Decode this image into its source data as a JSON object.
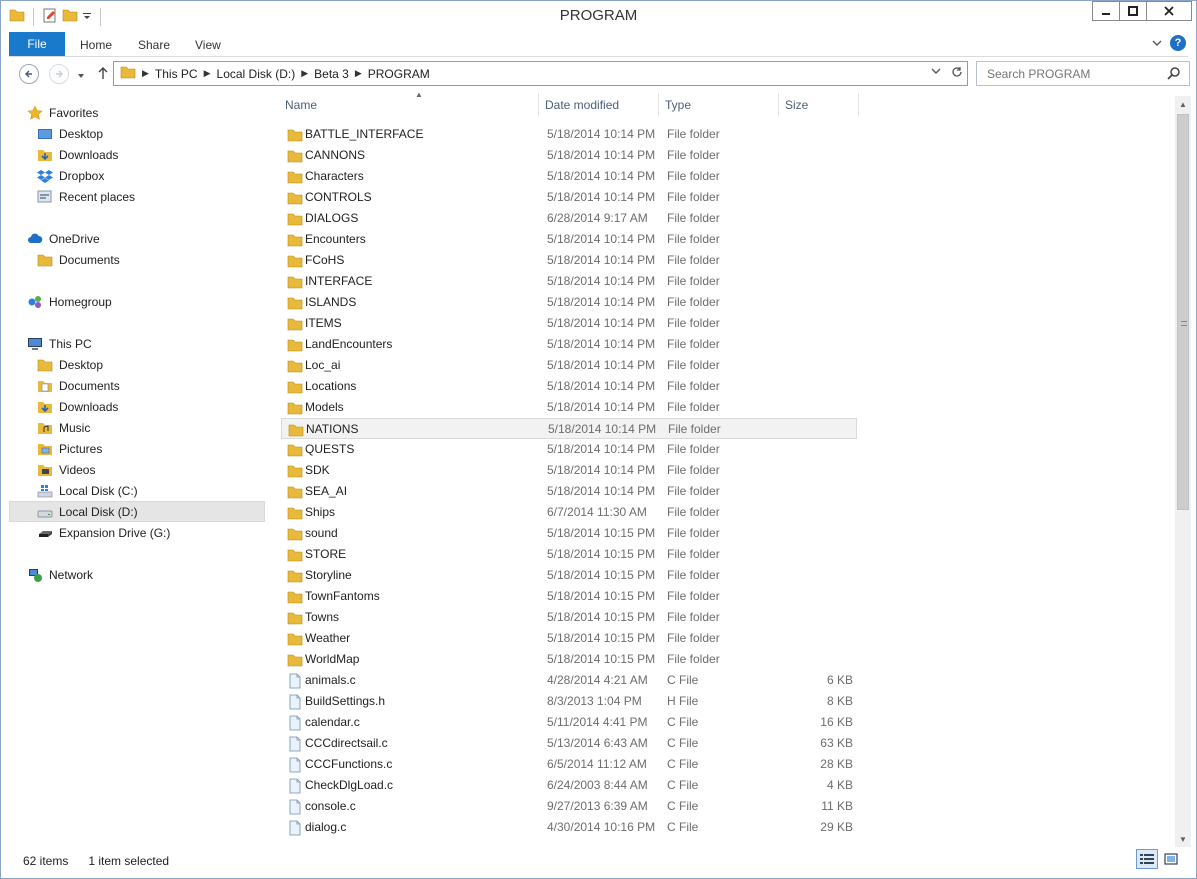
{
  "window": {
    "title": "PROGRAM"
  },
  "ribbon": {
    "file": "File",
    "home": "Home",
    "share": "Share",
    "view": "View"
  },
  "address": {
    "crumbs": [
      "This PC",
      "Local Disk (D:)",
      "Beta 3",
      "PROGRAM"
    ]
  },
  "search": {
    "placeholder": "Search PROGRAM"
  },
  "nav": {
    "favorites": "Favorites",
    "desktop": "Desktop",
    "downloads": "Downloads",
    "dropbox": "Dropbox",
    "recent": "Recent places",
    "onedrive": "OneDrive",
    "od_documents": "Documents",
    "homegroup": "Homegroup",
    "thispc": "This PC",
    "pc_desktop": "Desktop",
    "pc_documents": "Documents",
    "pc_downloads": "Downloads",
    "pc_music": "Music",
    "pc_pictures": "Pictures",
    "pc_videos": "Videos",
    "disk_c": "Local Disk (C:)",
    "disk_d": "Local Disk (D:)",
    "drive_g": "Expansion Drive (G:)",
    "network": "Network"
  },
  "columns": {
    "name": "Name",
    "date": "Date modified",
    "type": "Type",
    "size": "Size"
  },
  "files": [
    {
      "name": "BATTLE_INTERFACE",
      "date": "5/18/2014 10:14 PM",
      "type": "File folder",
      "size": "",
      "kind": "folder"
    },
    {
      "name": "CANNONS",
      "date": "5/18/2014 10:14 PM",
      "type": "File folder",
      "size": "",
      "kind": "folder"
    },
    {
      "name": "Characters",
      "date": "5/18/2014 10:14 PM",
      "type": "File folder",
      "size": "",
      "kind": "folder"
    },
    {
      "name": "CONTROLS",
      "date": "5/18/2014 10:14 PM",
      "type": "File folder",
      "size": "",
      "kind": "folder"
    },
    {
      "name": "DIALOGS",
      "date": "6/28/2014 9:17 AM",
      "type": "File folder",
      "size": "",
      "kind": "folder"
    },
    {
      "name": "Encounters",
      "date": "5/18/2014 10:14 PM",
      "type": "File folder",
      "size": "",
      "kind": "folder"
    },
    {
      "name": "FCoHS",
      "date": "5/18/2014 10:14 PM",
      "type": "File folder",
      "size": "",
      "kind": "folder"
    },
    {
      "name": "INTERFACE",
      "date": "5/18/2014 10:14 PM",
      "type": "File folder",
      "size": "",
      "kind": "folder"
    },
    {
      "name": "ISLANDS",
      "date": "5/18/2014 10:14 PM",
      "type": "File folder",
      "size": "",
      "kind": "folder"
    },
    {
      "name": "ITEMS",
      "date": "5/18/2014 10:14 PM",
      "type": "File folder",
      "size": "",
      "kind": "folder"
    },
    {
      "name": "LandEncounters",
      "date": "5/18/2014 10:14 PM",
      "type": "File folder",
      "size": "",
      "kind": "folder"
    },
    {
      "name": "Loc_ai",
      "date": "5/18/2014 10:14 PM",
      "type": "File folder",
      "size": "",
      "kind": "folder"
    },
    {
      "name": "Locations",
      "date": "5/18/2014 10:14 PM",
      "type": "File folder",
      "size": "",
      "kind": "folder"
    },
    {
      "name": "Models",
      "date": "5/18/2014 10:14 PM",
      "type": "File folder",
      "size": "",
      "kind": "folder"
    },
    {
      "name": "NATIONS",
      "date": "5/18/2014 10:14 PM",
      "type": "File folder",
      "size": "",
      "kind": "folder",
      "selected": true
    },
    {
      "name": "QUESTS",
      "date": "5/18/2014 10:14 PM",
      "type": "File folder",
      "size": "",
      "kind": "folder"
    },
    {
      "name": "SDK",
      "date": "5/18/2014 10:14 PM",
      "type": "File folder",
      "size": "",
      "kind": "folder"
    },
    {
      "name": "SEA_AI",
      "date": "5/18/2014 10:14 PM",
      "type": "File folder",
      "size": "",
      "kind": "folder"
    },
    {
      "name": "Ships",
      "date": "6/7/2014 11:30 AM",
      "type": "File folder",
      "size": "",
      "kind": "folder"
    },
    {
      "name": "sound",
      "date": "5/18/2014 10:15 PM",
      "type": "File folder",
      "size": "",
      "kind": "folder"
    },
    {
      "name": "STORE",
      "date": "5/18/2014 10:15 PM",
      "type": "File folder",
      "size": "",
      "kind": "folder"
    },
    {
      "name": "Storyline",
      "date": "5/18/2014 10:15 PM",
      "type": "File folder",
      "size": "",
      "kind": "folder"
    },
    {
      "name": "TownFantoms",
      "date": "5/18/2014 10:15 PM",
      "type": "File folder",
      "size": "",
      "kind": "folder"
    },
    {
      "name": "Towns",
      "date": "5/18/2014 10:15 PM",
      "type": "File folder",
      "size": "",
      "kind": "folder"
    },
    {
      "name": "Weather",
      "date": "5/18/2014 10:15 PM",
      "type": "File folder",
      "size": "",
      "kind": "folder"
    },
    {
      "name": "WorldMap",
      "date": "5/18/2014 10:15 PM",
      "type": "File folder",
      "size": "",
      "kind": "folder"
    },
    {
      "name": "animals.c",
      "date": "4/28/2014 4:21 AM",
      "type": "C File",
      "size": "6 KB",
      "kind": "file"
    },
    {
      "name": "BuildSettings.h",
      "date": "8/3/2013 1:04 PM",
      "type": "H File",
      "size": "8 KB",
      "kind": "file"
    },
    {
      "name": "calendar.c",
      "date": "5/11/2014 4:41 PM",
      "type": "C File",
      "size": "16 KB",
      "kind": "file"
    },
    {
      "name": "CCCdirectsail.c",
      "date": "5/13/2014 6:43 AM",
      "type": "C File",
      "size": "63 KB",
      "kind": "file"
    },
    {
      "name": "CCCFunctions.c",
      "date": "6/5/2014 11:12 AM",
      "type": "C File",
      "size": "28 KB",
      "kind": "file"
    },
    {
      "name": "CheckDlgLoad.c",
      "date": "6/24/2003 8:44 AM",
      "type": "C File",
      "size": "4 KB",
      "kind": "file"
    },
    {
      "name": "console.c",
      "date": "9/27/2013 6:39 AM",
      "type": "C File",
      "size": "11 KB",
      "kind": "file"
    },
    {
      "name": "dialog.c",
      "date": "4/30/2014 10:16 PM",
      "type": "C File",
      "size": "29 KB",
      "kind": "file"
    }
  ],
  "status": {
    "count": "62 items",
    "selected": "1 item selected"
  }
}
